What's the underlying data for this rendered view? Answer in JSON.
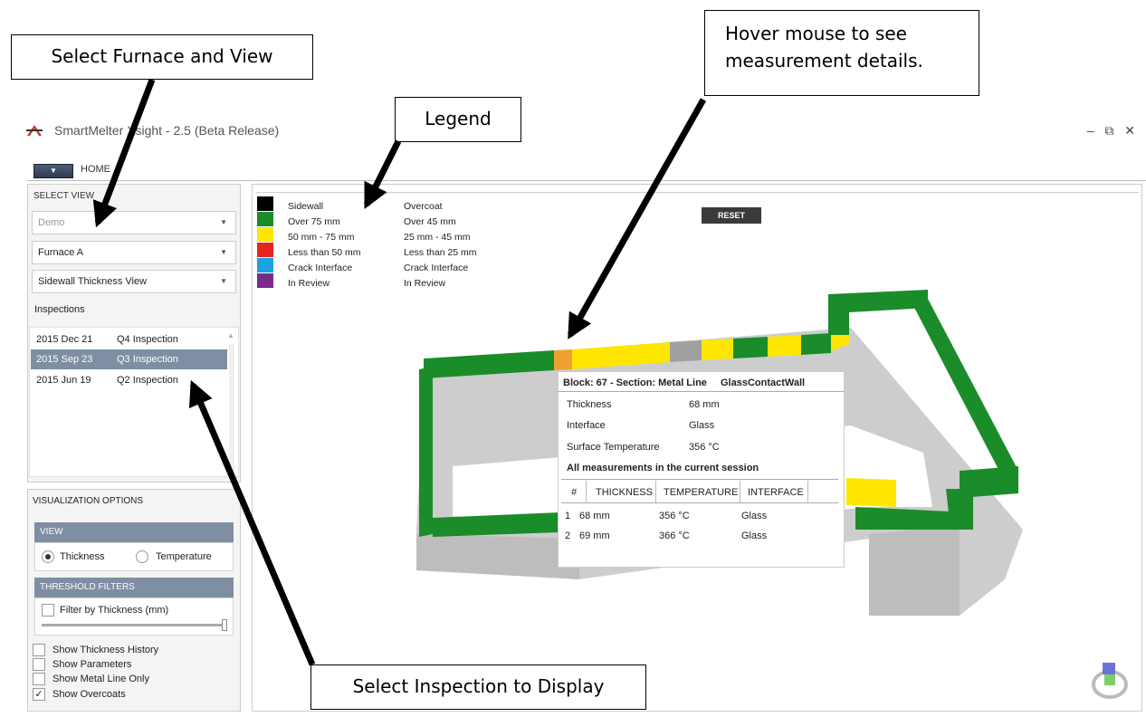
{
  "app": {
    "title": "SmartMelter Xsight - 2.5 (Beta Release)",
    "window_controls": "– ⧉ ✕",
    "menu_button": "▼",
    "tab_home": "HOME"
  },
  "left_panel": {
    "select_view_heading": "SELECT VIEW",
    "site_dropdown": "Demo",
    "furnace_dropdown": "Furnace A",
    "view_dropdown": "Sidewall Thickness View",
    "inspections_label": "Inspections",
    "inspections": [
      {
        "date": "2015 Dec 21",
        "name": "Q4 Inspection",
        "selected": false
      },
      {
        "date": "2015 Sep 23",
        "name": "Q3 Inspection",
        "selected": true
      },
      {
        "date": "2015 Jun 19",
        "name": "Q2 Inspection",
        "selected": false
      }
    ],
    "visualization_heading": "VISUALIZATION OPTIONS",
    "view_section": "VIEW",
    "radio_thickness": "Thickness",
    "radio_temperature": "Temperature",
    "threshold_section": "THRESHOLD FILTERS",
    "filter_thickness": "Filter by Thickness (mm)",
    "options": [
      {
        "label": "Show Thickness History",
        "checked": false
      },
      {
        "label": "Show Parameters",
        "checked": false
      },
      {
        "label": "Show Metal Line Only",
        "checked": false
      },
      {
        "label": "Show Overcoats",
        "checked": true
      }
    ]
  },
  "legend": {
    "rows": [
      {
        "color": "#000000",
        "sidewall": "Sidewall",
        "overcoat": "Overcoat"
      },
      {
        "color": "#1a8c2a",
        "sidewall": "Over 75 mm",
        "overcoat": "Over 45 mm"
      },
      {
        "color": "#ffe600",
        "sidewall": "50 mm - 75 mm",
        "overcoat": "25 mm - 45 mm"
      },
      {
        "color": "#e8231c",
        "sidewall": "Less than 50 mm",
        "overcoat": "Less than 25 mm"
      },
      {
        "color": "#1aa3e0",
        "sidewall": "Crack Interface",
        "overcoat": "Crack Interface"
      },
      {
        "color": "#7b2a8c",
        "sidewall": "In Review",
        "overcoat": "In Review"
      }
    ]
  },
  "reset_label": "RESET",
  "tooltip": {
    "header_block": "Block: 67 - Section: Metal Line",
    "header_wall": "GlassContactWall",
    "thickness_label": "Thickness",
    "thickness_value": "68 mm",
    "interface_label": "Interface",
    "interface_value": "Glass",
    "temp_label": "Surface Temperature",
    "temp_value": "356 °C",
    "session_heading": "All measurements in the current session",
    "columns": [
      "#",
      "THICKNESS",
      "TEMPERATURE",
      "INTERFACE"
    ],
    "rows": [
      [
        "1",
        "68 mm",
        "356 °C",
        "Glass"
      ],
      [
        "2",
        "69 mm",
        "366 °C",
        "Glass"
      ]
    ]
  },
  "annotations": {
    "select_furnace": "Select Furnace and View",
    "legend": "Legend",
    "hover_line1": "Hover mouse to see",
    "hover_line2": "measurement details.",
    "select_inspection": "Select Inspection to Display"
  },
  "colors": {
    "green": "#1a8c2a",
    "yellow": "#ffe600",
    "orange": "#f0a030",
    "grey_block": "#c8c8c8",
    "selected_row": "#7f8ea2"
  }
}
